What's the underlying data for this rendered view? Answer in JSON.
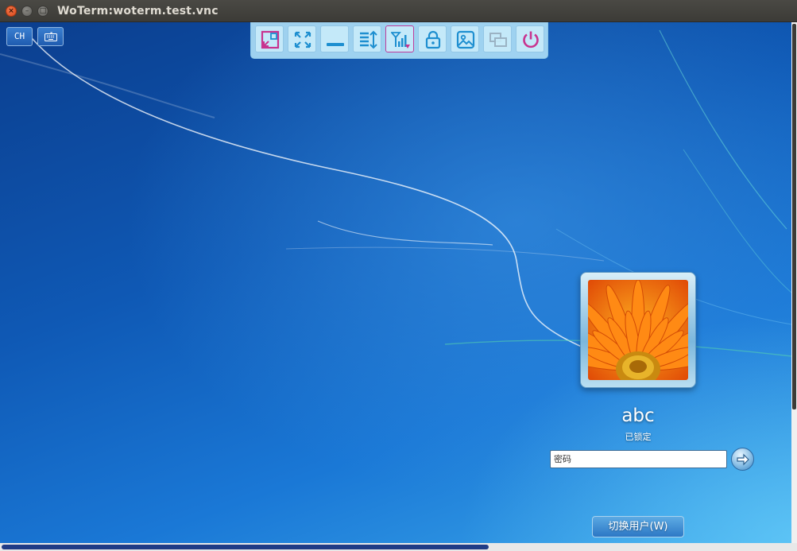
{
  "window": {
    "title": "WoTerm:woterm.test.vnc",
    "close_glyph": "×",
    "minimize_glyph": "–",
    "maximize_glyph": "□"
  },
  "left_controls": {
    "ime_label": "CH",
    "keyboard_icon": "keyboard-icon"
  },
  "toolbar": {
    "buttons": [
      {
        "icon": "restore-window-icon",
        "active": false
      },
      {
        "icon": "fullscreen-icon",
        "active": false
      },
      {
        "icon": "minimize-icon",
        "active": false
      },
      {
        "icon": "scroll-adjust-icon",
        "active": false
      },
      {
        "icon": "signal-quality-icon",
        "active": true
      },
      {
        "icon": "lock-icon",
        "active": false
      },
      {
        "icon": "image-icon",
        "active": false
      },
      {
        "icon": "multi-window-icon",
        "active": false
      },
      {
        "icon": "power-icon",
        "active": false
      }
    ],
    "colors": {
      "pink": "#c8338f",
      "blue": "#1e8fd0",
      "grey": "#9bb3c4"
    }
  },
  "login": {
    "username": "abc",
    "status": "已锁定",
    "password_placeholder": "密码",
    "switch_user_label": "切换用户(W)"
  }
}
